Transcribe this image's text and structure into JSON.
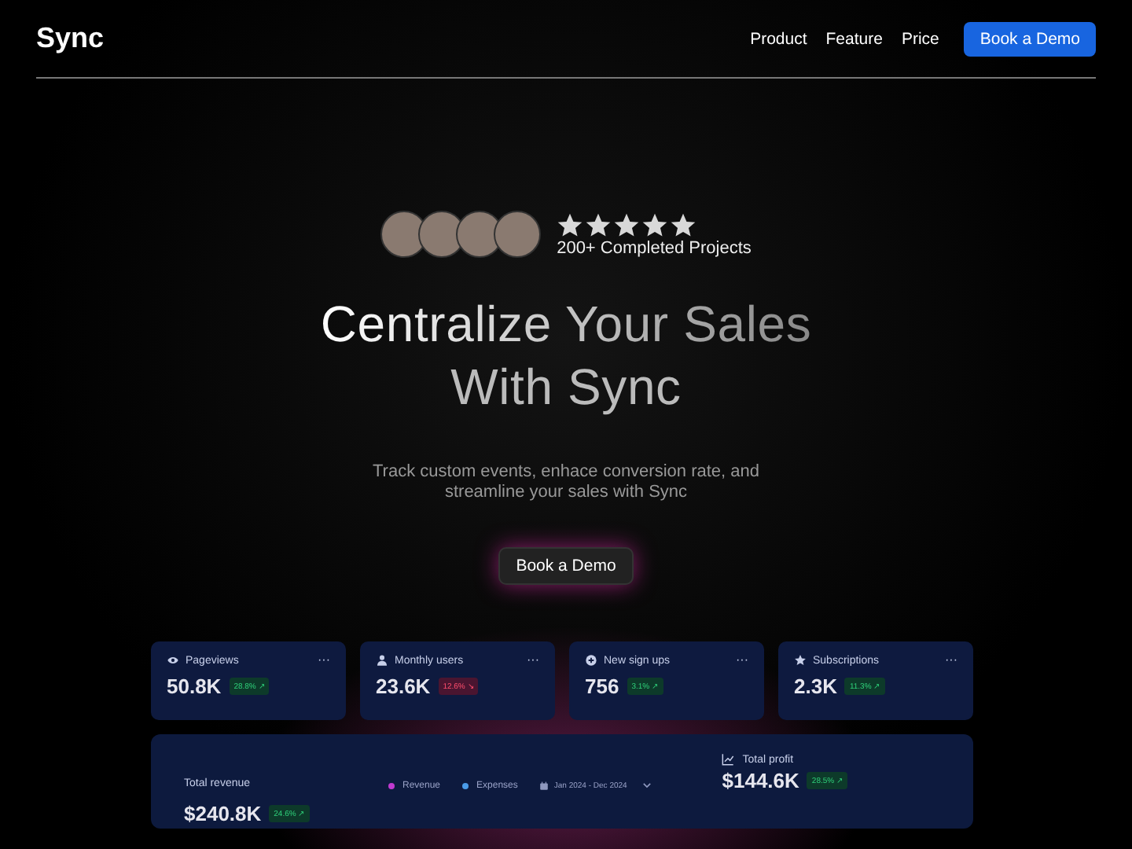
{
  "nav": {
    "logo": "Sync",
    "links": [
      {
        "label": "Product"
      },
      {
        "label": "Feature"
      },
      {
        "label": "Price"
      }
    ],
    "cta": "Book a Demo"
  },
  "hero": {
    "rating": {
      "stars": 5
    },
    "proof": "200+ Completed Projects",
    "title_lines": [
      "Centralize Your Sales",
      "With Sync"
    ],
    "subtitle_lines": [
      "Track custom events, enhace conversion rate, and",
      "streamline your sales with Sync"
    ],
    "cta": "Book a Demo"
  },
  "stats": [
    {
      "label": "Pageviews",
      "value": "50.8K",
      "change": "28.8% ↗",
      "kind": "up",
      "menu": "···"
    },
    {
      "label": "Monthly users",
      "value": "23.6K",
      "change": "12.6% ↘",
      "kind": "down",
      "menu": "···"
    },
    {
      "label": "New sign ups",
      "value": "756",
      "change": "3.1% ↗",
      "kind": "up",
      "menu": "···"
    },
    {
      "label": "Subscriptions",
      "value": "2.3K",
      "change": "11.3% ↗",
      "kind": "up",
      "menu": "···"
    }
  ],
  "revenue": {
    "label": "Total revenue",
    "value": "$240.8K",
    "change": "24.6% ↗",
    "kind": "up",
    "legend": [
      {
        "label": "Revenue",
        "color": "#c03ad0"
      },
      {
        "label": "Expenses",
        "color": "#4a9be8"
      }
    ],
    "date_range": "Jan 2024 - Dec 2024",
    "profit": {
      "label": "Total profit",
      "value": "$144.6K",
      "change": "28.5% ↗",
      "kind": "up"
    }
  }
}
